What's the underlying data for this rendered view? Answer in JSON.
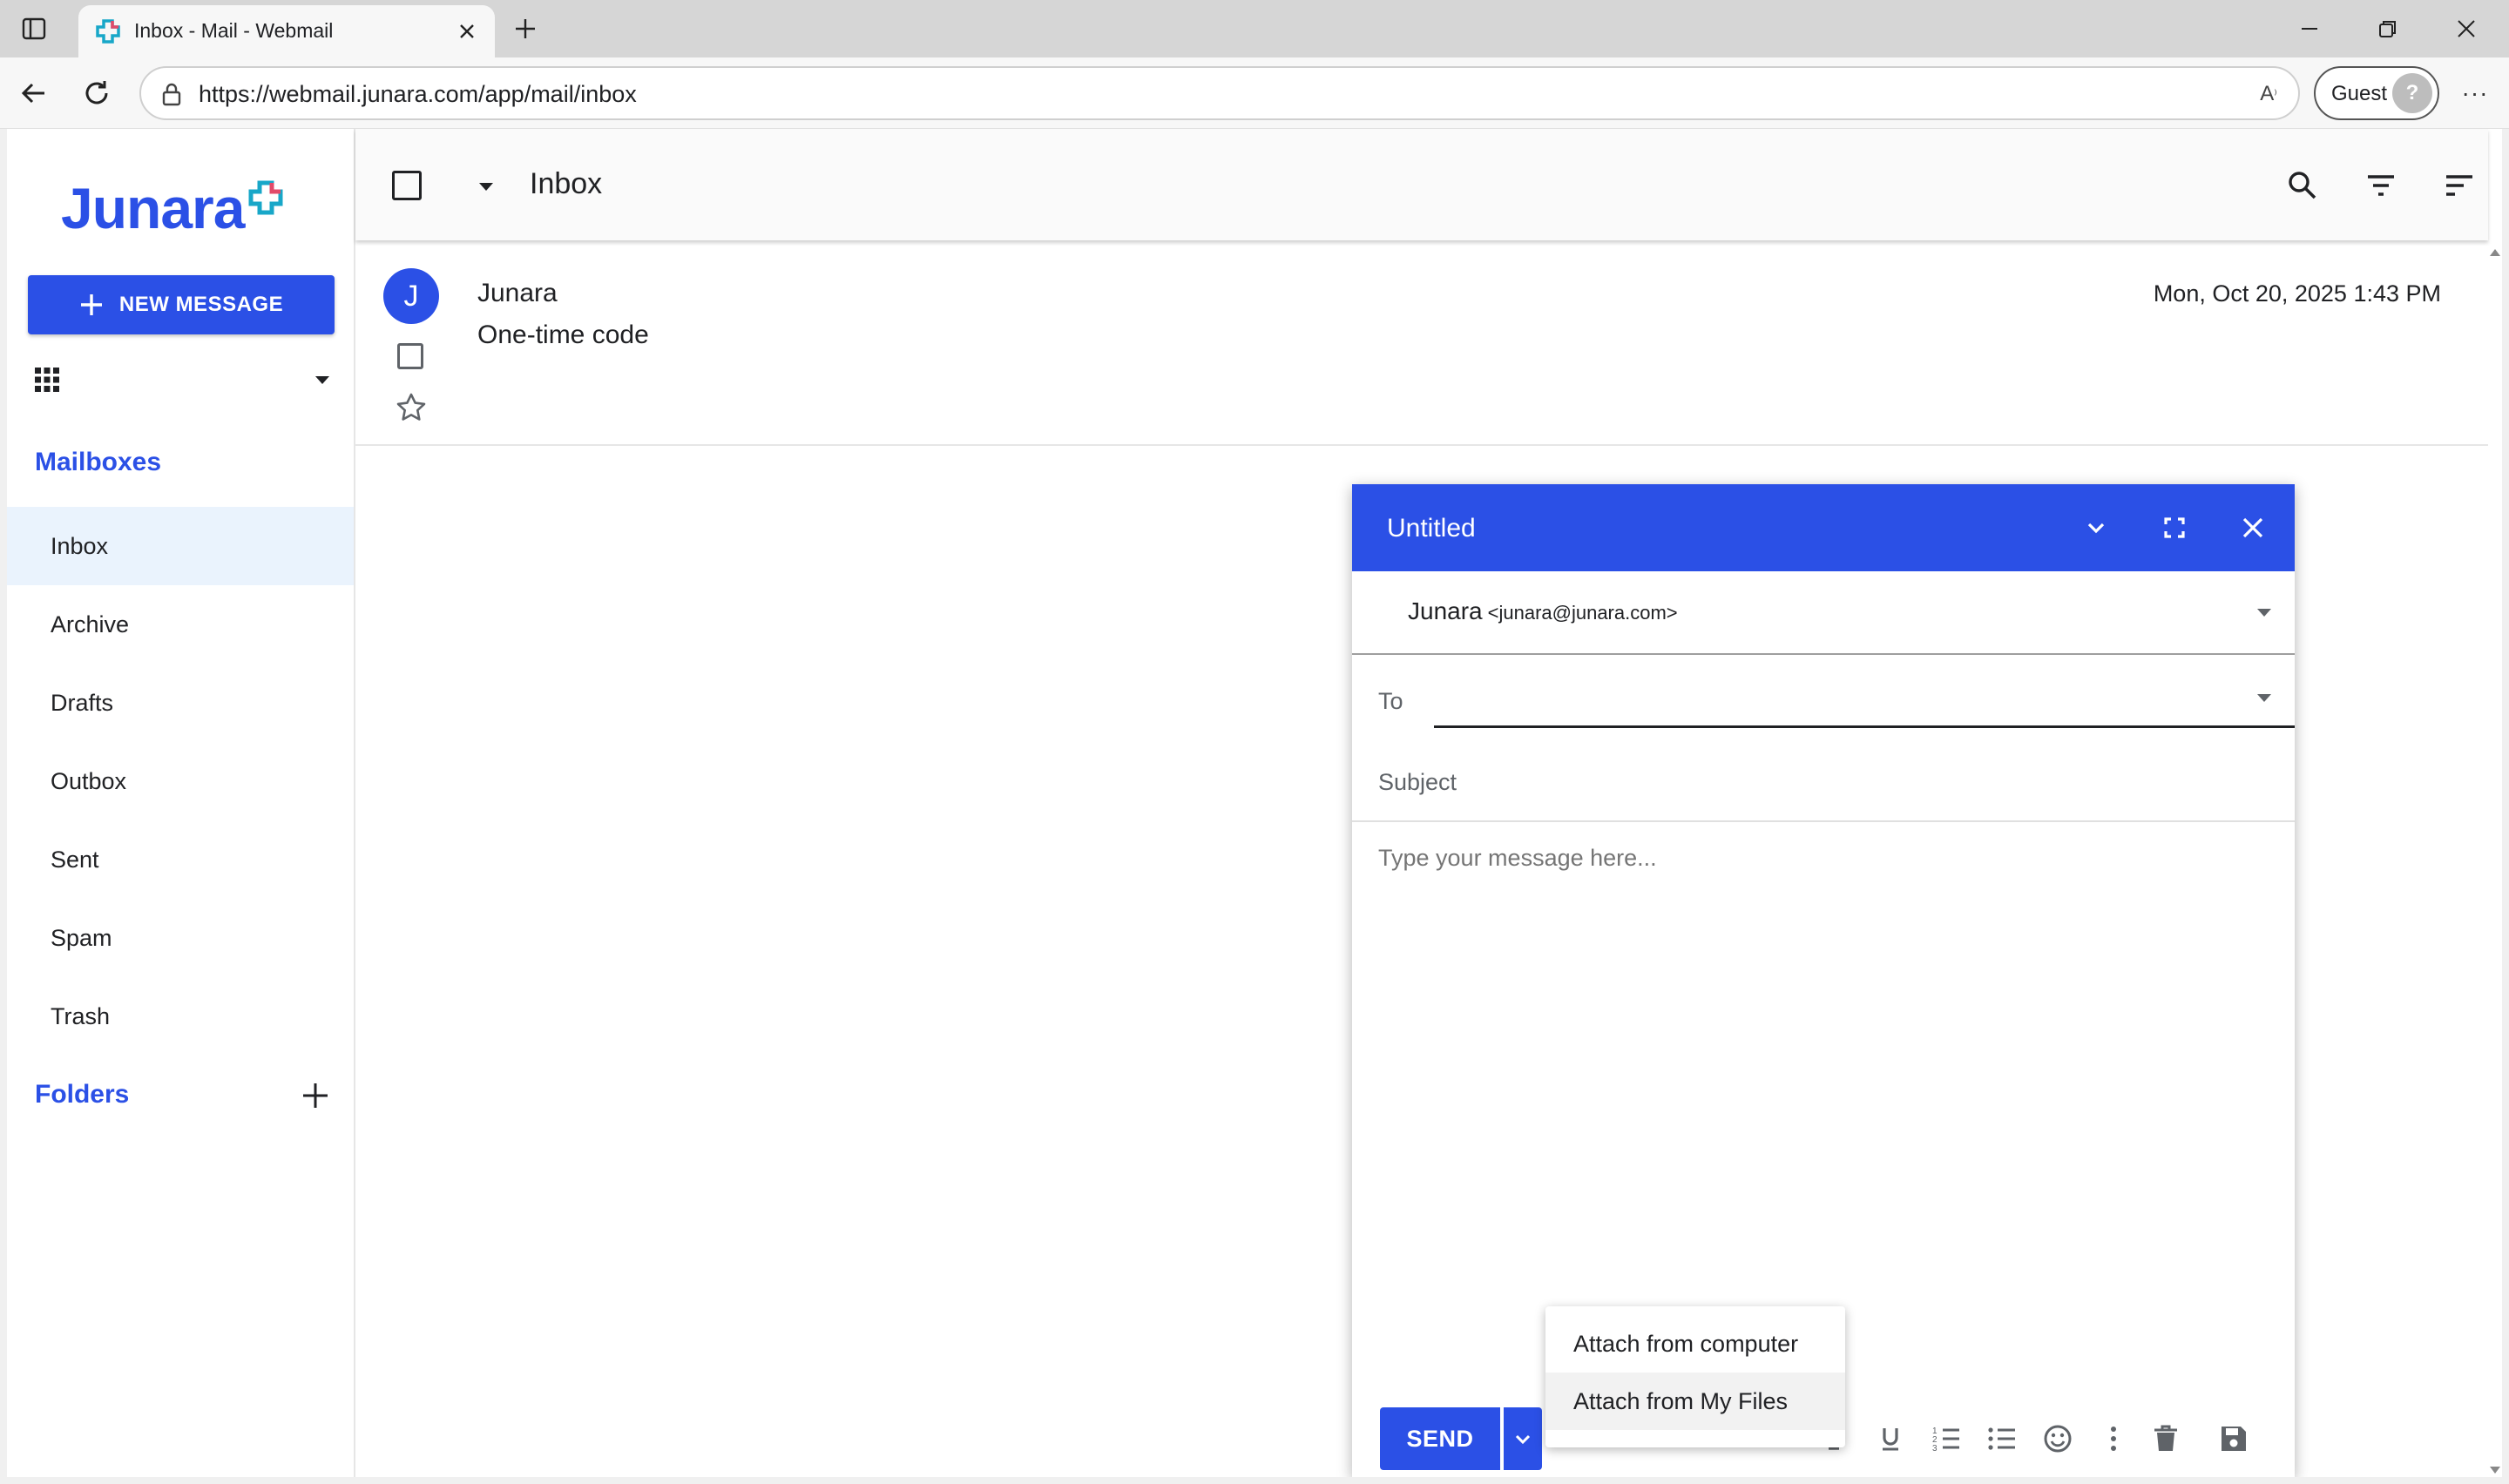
{
  "browser": {
    "tab_title": "Inbox - Mail - Webmail",
    "url": "https://webmail.junara.com/app/mail/inbox",
    "profile_label": "Guest"
  },
  "app": {
    "brand": "Junara",
    "brand_color": "#2b50e6",
    "new_message_label": "NEW MESSAGE",
    "mailboxes_title": "Mailboxes",
    "mailboxes": [
      {
        "label": "Inbox",
        "active": true
      },
      {
        "label": "Archive"
      },
      {
        "label": "Drafts"
      },
      {
        "label": "Outbox"
      },
      {
        "label": "Sent"
      },
      {
        "label": "Spam"
      },
      {
        "label": "Trash"
      }
    ],
    "folders_title": "Folders"
  },
  "list": {
    "title": "Inbox",
    "messages": [
      {
        "avatar_letter": "J",
        "sender": "Junara",
        "subject": "One-time code",
        "date": "Mon, Oct 20, 2025 1:43 PM"
      }
    ]
  },
  "compose": {
    "title": "Untitled",
    "from_name": "Junara",
    "from_email": "<junara@junara.com>",
    "to_label": "To",
    "to_value": "",
    "subject_placeholder": "Subject",
    "subject_value": "",
    "body_placeholder": "Type your message here...",
    "send_label": "SEND"
  },
  "attach_menu": {
    "items": [
      "Attach from computer",
      "Attach from My Files"
    ],
    "hovered_index": 1
  },
  "icons": {
    "header": [
      "search-icon",
      "filter-icon",
      "sort-icon"
    ],
    "compose_header": [
      "minimize-icon",
      "fullscreen-icon",
      "close-icon"
    ],
    "toolbar": [
      "italic-icon",
      "underline-icon",
      "numbered-list-icon",
      "bullet-list-icon",
      "emoji-icon",
      "more-vert-icon",
      "delete-icon",
      "save-icon"
    ]
  }
}
